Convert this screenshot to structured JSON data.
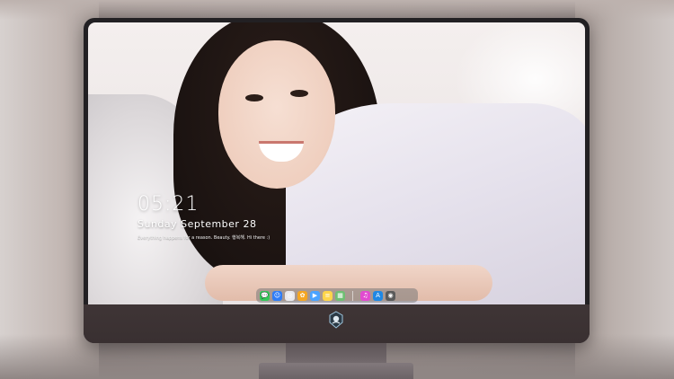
{
  "lockscreen": {
    "time": "05:21",
    "date": "Sunday September  28",
    "quote": "Everything happens for a reason. Beauty. 행복해. Hi there :)"
  },
  "dock": {
    "apps": [
      {
        "name": "messages-icon",
        "glyph": "💬",
        "color": "#34c759"
      },
      {
        "name": "finder-icon",
        "glyph": "☺",
        "color": "#2f7cf6"
      },
      {
        "name": "safari-icon",
        "glyph": "◎",
        "color": "#e9e9ee"
      },
      {
        "name": "photos-icon",
        "glyph": "✿",
        "color": "#f5a623"
      },
      {
        "name": "videos-icon",
        "glyph": "▶",
        "color": "#4aa3ff"
      },
      {
        "name": "notes-icon",
        "glyph": "≡",
        "color": "#ffd54a"
      },
      {
        "name": "preview-icon",
        "glyph": "▦",
        "color": "#6fbf73"
      },
      {
        "name": "music-icon",
        "glyph": "♫",
        "color": "#e14bd0"
      },
      {
        "name": "app-store-icon",
        "glyph": "A",
        "color": "#1e88e5"
      },
      {
        "name": "camera-icon",
        "glyph": "◉",
        "color": "#5a5a5a"
      }
    ]
  },
  "colors": {
    "bezel": "#222023",
    "chin": "#3f3536",
    "stand": "#736a6d"
  }
}
